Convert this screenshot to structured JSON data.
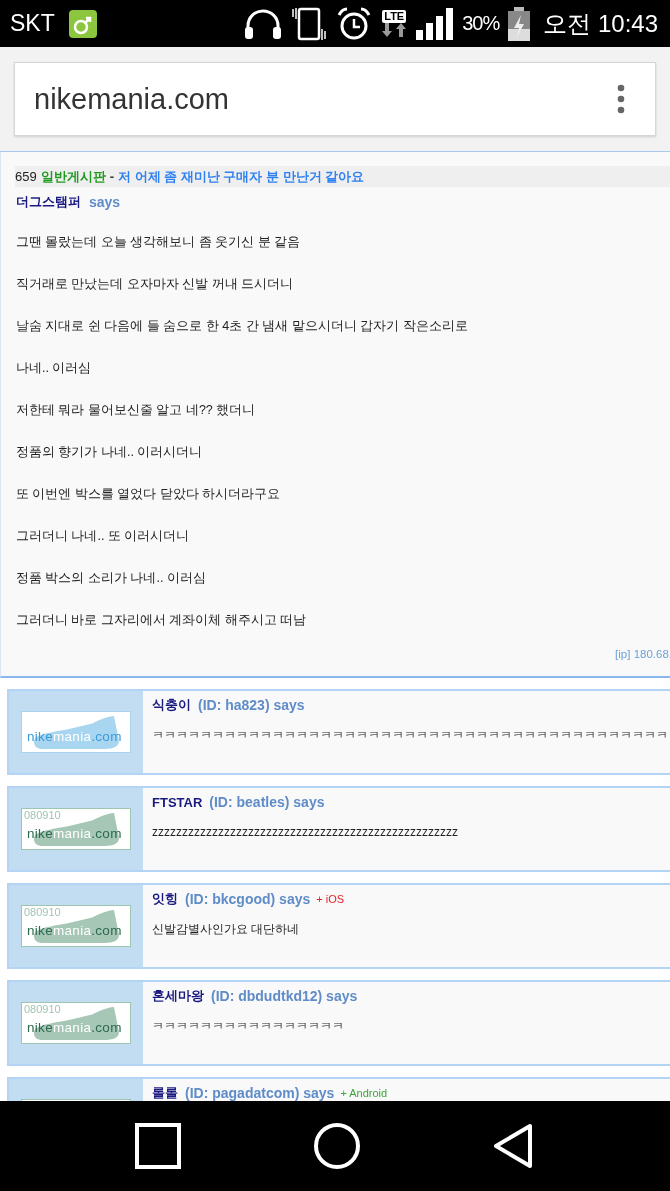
{
  "status_bar": {
    "carrier": "SKT",
    "network": "LTE",
    "battery": "30%",
    "time": "오전 10:43"
  },
  "address_bar": {
    "url": "nikemania.com"
  },
  "post": {
    "number": "659",
    "board": "일반게시판",
    "separator": "-",
    "title": "저 어제 좀 재미난 구매자 분 만난거 같아요",
    "author": "더그스탬퍼",
    "says": "says",
    "paragraphs": [
      "그땐 몰랐는데 오늘 생각해보니 좀 웃기신 분 같음",
      "직거래로 만났는데 오자마자 신발 꺼내 드시더니",
      "날숨 지대로 쉰 다음에 들 숨으로 한 4초 간 냄새 맡으시더니 갑자기 작은소리로",
      "나네.. 이러심",
      "저한테 뭐라 물어보신줄 알고 네?? 했더니",
      "정품의 향기가 나네.. 이러시더니",
      "또 이번엔 박스를 열었다 닫았다 하시더라구요",
      "그러더니 나네.. 또 이러시더니",
      "정품 박스의 소리가 나네.. 이러심",
      "그러더니 바로 그자리에서 계좌이체 해주시고 떠남"
    ],
    "ip": "[ip] 180.68."
  },
  "comments": [
    {
      "logo": {
        "kind": "light",
        "parts": [
          "nike",
          "mania",
          ".com"
        ]
      },
      "name": "식충이",
      "id": "(ID: ha823) says",
      "text": "ㅋㅋㅋㅋㅋㅋㅋㅋㅋㅋㅋㅋㅋㅋㅋㅋㅋㅋㅋㅋㅋㅋㅋㅋㅋㅋㅋㅋㅋㅋㅋㅋㅋㅋㅋㅋㅋㅋㅋㅋㅋㅋㅋ"
    },
    {
      "logo": {
        "kind": "muted",
        "stamp": "080910",
        "parts": [
          "nike",
          "mania",
          ".com"
        ]
      },
      "name": "FTSTAR",
      "id": "(ID: beatles) says",
      "text": "zzzzzzzzzzzzzzzzzzzzzzzzzzzzzzzzzzzzzzzzzzzzzzzzzzz"
    },
    {
      "logo": {
        "kind": "muted",
        "stamp": "080910",
        "parts": [
          "nike",
          "mania",
          ".com"
        ]
      },
      "name": "잇힝",
      "id": "(ID: bkcgood) says",
      "device": {
        "label": "+ iOS",
        "color": "#e8202a"
      },
      "text": "신발감별사인가요 대단하네"
    },
    {
      "logo": {
        "kind": "muted",
        "stamp": "080910",
        "parts": [
          "nike",
          "mania",
          ".com"
        ]
      },
      "name": "혼세마왕",
      "id": "(ID: dbdudtkd12) says",
      "text": "ㅋㅋㅋㅋㅋㅋㅋㅋㅋㅋㅋㅋㅋㅋㅋㅋ"
    },
    {
      "logo": {
        "kind": "muted"
      },
      "name": "롤롤",
      "id": "(ID: pagadatcom) says",
      "device": {
        "label": "+ Android",
        "color": "#3aa63a"
      }
    }
  ]
}
